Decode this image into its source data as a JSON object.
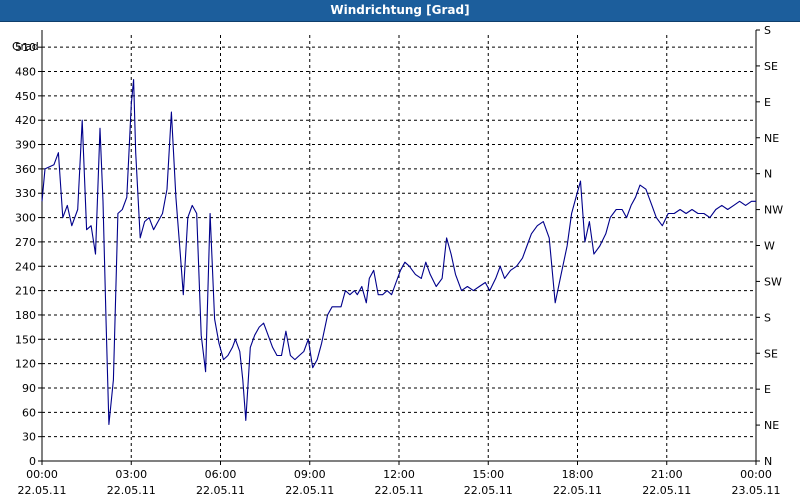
{
  "window": {
    "title": "Windrichtung [Grad]"
  },
  "colors": {
    "titlebar": "#1c5e9c",
    "series": "#00008b",
    "grid": "#000000"
  },
  "chart_data": {
    "type": "line",
    "title": "Windrichtung [Grad]",
    "ylabel": "Grad",
    "ylim": [
      0,
      525
    ],
    "xlim": [
      0,
      24
    ],
    "grid": true,
    "y_ticks": [
      0,
      30,
      60,
      90,
      120,
      150,
      180,
      210,
      240,
      270,
      300,
      330,
      360,
      390,
      420,
      450,
      480,
      510
    ],
    "x_ticks": [
      {
        "h": 0,
        "time": "00:00",
        "date": "22.05.11"
      },
      {
        "h": 3,
        "time": "03:00",
        "date": "22.05.11"
      },
      {
        "h": 6,
        "time": "06:00",
        "date": "22.05.11"
      },
      {
        "h": 9,
        "time": "09:00",
        "date": "22.05.11"
      },
      {
        "h": 12,
        "time": "12:00",
        "date": "22.05.11"
      },
      {
        "h": 15,
        "time": "15:00",
        "date": "22.05.11"
      },
      {
        "h": 18,
        "time": "18:00",
        "date": "22.05.11"
      },
      {
        "h": 21,
        "time": "21:00",
        "date": "22.05.11"
      },
      {
        "h": 24,
        "time": "00:00",
        "date": "23.05.11"
      }
    ],
    "right_ticks": [
      {
        "v": 0,
        "label": "N"
      },
      {
        "v": 45,
        "label": "NE"
      },
      {
        "v": 90,
        "label": "E"
      },
      {
        "v": 135,
        "label": "SE"
      },
      {
        "v": 180,
        "label": "S"
      },
      {
        "v": 225,
        "label": "SW"
      },
      {
        "v": 270,
        "label": "W"
      },
      {
        "v": 315,
        "label": "NW"
      },
      {
        "v": 360,
        "label": "N"
      },
      {
        "v": 405,
        "label": "NE"
      },
      {
        "v": 450,
        "label": "E"
      },
      {
        "v": 495,
        "label": "SE"
      },
      {
        "v": 540,
        "label": "S"
      }
    ],
    "series": [
      {
        "values": [
          [
            0.0,
            320
          ],
          [
            0.1,
            360
          ],
          [
            0.4,
            365
          ],
          [
            0.55,
            380
          ],
          [
            0.7,
            300
          ],
          [
            0.85,
            315
          ],
          [
            1.0,
            290
          ],
          [
            1.2,
            310
          ],
          [
            1.35,
            420
          ],
          [
            1.5,
            285
          ],
          [
            1.65,
            290
          ],
          [
            1.8,
            255
          ],
          [
            1.95,
            410
          ],
          [
            2.05,
            320
          ],
          [
            2.15,
            175
          ],
          [
            2.25,
            45
          ],
          [
            2.4,
            100
          ],
          [
            2.55,
            305
          ],
          [
            2.7,
            310
          ],
          [
            2.85,
            325
          ],
          [
            3.0,
            440
          ],
          [
            3.08,
            470
          ],
          [
            3.15,
            380
          ],
          [
            3.3,
            275
          ],
          [
            3.45,
            295
          ],
          [
            3.6,
            300
          ],
          [
            3.75,
            285
          ],
          [
            3.9,
            295
          ],
          [
            4.05,
            305
          ],
          [
            4.2,
            335
          ],
          [
            4.35,
            430
          ],
          [
            4.5,
            325
          ],
          [
            4.65,
            255
          ],
          [
            4.75,
            205
          ],
          [
            4.9,
            300
          ],
          [
            5.05,
            315
          ],
          [
            5.2,
            305
          ],
          [
            5.35,
            155
          ],
          [
            5.5,
            110
          ],
          [
            5.65,
            305
          ],
          [
            5.8,
            175
          ],
          [
            5.95,
            145
          ],
          [
            6.1,
            125
          ],
          [
            6.25,
            130
          ],
          [
            6.4,
            140
          ],
          [
            6.5,
            150
          ],
          [
            6.65,
            135
          ],
          [
            6.75,
            100
          ],
          [
            6.85,
            50
          ],
          [
            7.0,
            140
          ],
          [
            7.15,
            155
          ],
          [
            7.3,
            165
          ],
          [
            7.45,
            170
          ],
          [
            7.6,
            155
          ],
          [
            7.75,
            140
          ],
          [
            7.9,
            130
          ],
          [
            8.05,
            130
          ],
          [
            8.2,
            160
          ],
          [
            8.35,
            130
          ],
          [
            8.5,
            125
          ],
          [
            8.65,
            130
          ],
          [
            8.8,
            135
          ],
          [
            8.95,
            150
          ],
          [
            9.1,
            115
          ],
          [
            9.25,
            125
          ],
          [
            9.4,
            145
          ],
          [
            9.6,
            180
          ],
          [
            9.75,
            190
          ],
          [
            9.9,
            190
          ],
          [
            10.05,
            190
          ],
          [
            10.2,
            210
          ],
          [
            10.35,
            205
          ],
          [
            10.5,
            210
          ],
          [
            10.6,
            205
          ],
          [
            10.75,
            215
          ],
          [
            10.9,
            195
          ],
          [
            11.0,
            225
          ],
          [
            11.15,
            235
          ],
          [
            11.3,
            205
          ],
          [
            11.45,
            205
          ],
          [
            11.6,
            210
          ],
          [
            11.75,
            205
          ],
          [
            11.9,
            220
          ],
          [
            12.05,
            235
          ],
          [
            12.2,
            245
          ],
          [
            12.35,
            240
          ],
          [
            12.55,
            230
          ],
          [
            12.75,
            225
          ],
          [
            12.9,
            245
          ],
          [
            13.05,
            230
          ],
          [
            13.25,
            215
          ],
          [
            13.45,
            225
          ],
          [
            13.6,
            275
          ],
          [
            13.75,
            255
          ],
          [
            13.9,
            230
          ],
          [
            14.1,
            210
          ],
          [
            14.3,
            215
          ],
          [
            14.5,
            210
          ],
          [
            14.7,
            215
          ],
          [
            14.9,
            220
          ],
          [
            15.05,
            210
          ],
          [
            15.25,
            225
          ],
          [
            15.4,
            240
          ],
          [
            15.55,
            225
          ],
          [
            15.75,
            235
          ],
          [
            15.95,
            240
          ],
          [
            16.15,
            250
          ],
          [
            16.3,
            265
          ],
          [
            16.45,
            280
          ],
          [
            16.65,
            290
          ],
          [
            16.85,
            295
          ],
          [
            17.05,
            275
          ],
          [
            17.25,
            195
          ],
          [
            17.45,
            230
          ],
          [
            17.65,
            265
          ],
          [
            17.8,
            305
          ],
          [
            17.95,
            325
          ],
          [
            18.1,
            345
          ],
          [
            18.25,
            270
          ],
          [
            18.4,
            295
          ],
          [
            18.55,
            255
          ],
          [
            18.75,
            265
          ],
          [
            18.95,
            280
          ],
          [
            19.1,
            300
          ],
          [
            19.3,
            310
          ],
          [
            19.5,
            310
          ],
          [
            19.65,
            300
          ],
          [
            19.8,
            315
          ],
          [
            19.95,
            325
          ],
          [
            20.1,
            340
          ],
          [
            20.3,
            335
          ],
          [
            20.5,
            315
          ],
          [
            20.65,
            300
          ],
          [
            20.85,
            290
          ],
          [
            21.05,
            305
          ],
          [
            21.25,
            305
          ],
          [
            21.45,
            310
          ],
          [
            21.65,
            305
          ],
          [
            21.85,
            310
          ],
          [
            22.05,
            305
          ],
          [
            22.25,
            305
          ],
          [
            22.45,
            300
          ],
          [
            22.65,
            310
          ],
          [
            22.85,
            315
          ],
          [
            23.05,
            310
          ],
          [
            23.25,
            315
          ],
          [
            23.45,
            320
          ],
          [
            23.65,
            315
          ],
          [
            23.85,
            320
          ],
          [
            24.0,
            320
          ]
        ]
      }
    ]
  }
}
